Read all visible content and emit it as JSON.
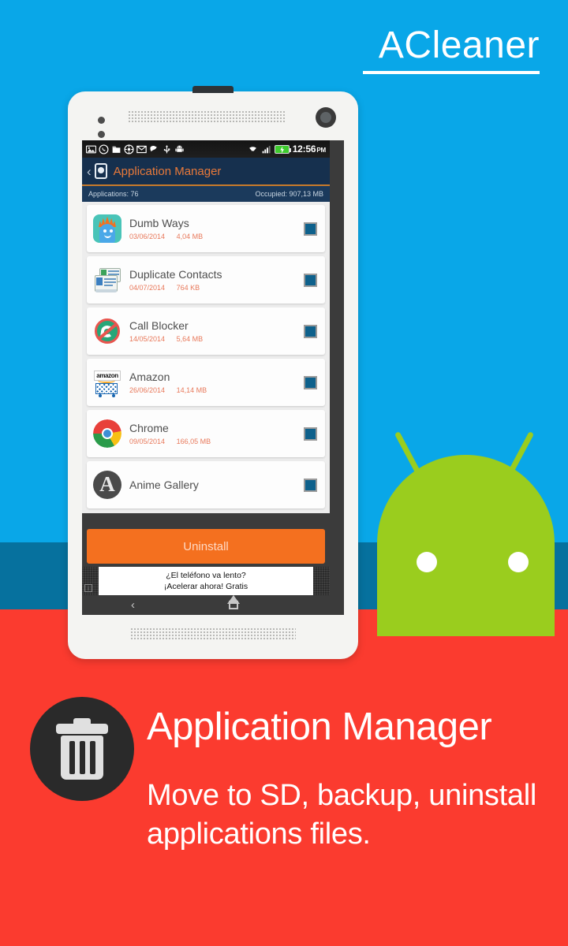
{
  "brand": {
    "name": "ACleaner"
  },
  "theme": {
    "sky_blue": "#09A7E8",
    "teal_band": "#06719E",
    "red_band": "#FB3B2F",
    "android_green": "#9ACD1E",
    "accent_orange": "#F4701F",
    "actionbar_navy": "#16304E",
    "checkbox_blue": "#0E618C"
  },
  "phone": {
    "statusbar": {
      "icons": [
        "image-icon",
        "whatsapp-icon",
        "folder-icon",
        "media-player-icon",
        "mail-icon",
        "firefox-icon",
        "usb-icon",
        "android-robot-icon"
      ],
      "right_icons": [
        "wifi-icon",
        "signal-icon",
        "battery-icon"
      ],
      "time": "12:56",
      "meridiem": "PM"
    },
    "actionbar": {
      "back_label": "‹",
      "icon": "phone-app-icon",
      "title": "Application Manager"
    },
    "infobar": {
      "applications_label": "Applications: 76",
      "occupied_label": "Occupied: 907,13 MB"
    },
    "apps": [
      {
        "name": "Dumb Ways",
        "date": "03/06/2014",
        "size": "4,04 MB",
        "icon": "dumb-ways-icon",
        "checked": true
      },
      {
        "name": "Duplicate Contacts",
        "date": "04/07/2014",
        "size": "764 KB",
        "icon": "duplicate-contacts-icon",
        "checked": true
      },
      {
        "name": "Call Blocker",
        "date": "14/05/2014",
        "size": "5,64 MB",
        "icon": "call-blocker-icon",
        "checked": true
      },
      {
        "name": "Amazon",
        "date": "26/06/2014",
        "size": "14,14 MB",
        "icon": "amazon-icon",
        "checked": true
      },
      {
        "name": "Chrome",
        "date": "09/05/2014",
        "size": "166,05 MB",
        "icon": "chrome-icon",
        "checked": true
      },
      {
        "name": "Anime Gallery",
        "date": "",
        "size": "",
        "icon": "anime-gallery-icon",
        "checked": true
      }
    ],
    "amazon_wordmark": "amazon",
    "anime_letter": "A",
    "uninstall_label": "Uninstall",
    "ad": {
      "line1": "¿El teléfono va lento?",
      "line2": "¡Acelerar ahora! Gratis",
      "info_glyph": "i"
    },
    "navbar": {
      "back": "back-icon",
      "home": "home-icon"
    }
  },
  "promo": {
    "icon": "trash-can-icon",
    "title": "Application Manager",
    "description": "Move to SD, backup, uninstall applications files."
  }
}
